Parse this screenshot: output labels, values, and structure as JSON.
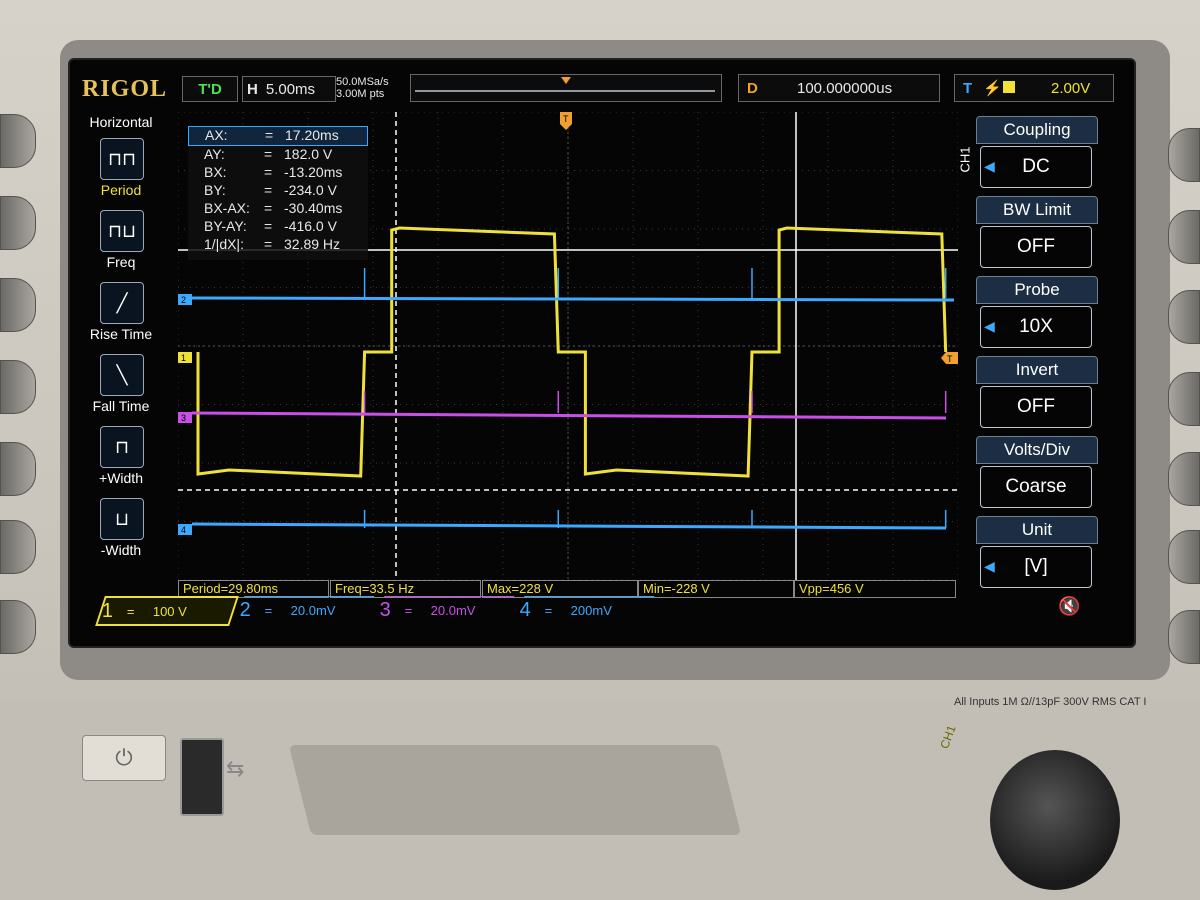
{
  "brand": "RIGOL",
  "topbar": {
    "trigger_status": "T'D",
    "horizontal_letter": "H",
    "timebase": "5.00ms",
    "sample_rate": "50.0MSa/s",
    "memory_depth": "3.00M pts",
    "delay_label": "D",
    "delay_value": "100.000000us",
    "trigger_letter": "T",
    "trigger_edge_icon": "rising-edge-icon",
    "trigger_level": "2.00V"
  },
  "left_menu": {
    "title": "Horizontal",
    "items": [
      {
        "label": "Period",
        "icon": "period-icon",
        "selected": true
      },
      {
        "label": "Freq",
        "icon": "freq-icon",
        "selected": false
      },
      {
        "label": "Rise Time",
        "icon": "rise-time-icon",
        "selected": false
      },
      {
        "label": "Fall Time",
        "icon": "fall-time-icon",
        "selected": false
      },
      {
        "label": "+Width",
        "icon": "pos-width-icon",
        "selected": false
      },
      {
        "label": "-Width",
        "icon": "neg-width-icon",
        "selected": false
      }
    ]
  },
  "cursor_readout": {
    "rows": [
      {
        "key": "AX:",
        "value": "17.20ms"
      },
      {
        "key": "AY:",
        "value": "182.0 V"
      },
      {
        "key": "BX:",
        "value": "-13.20ms"
      },
      {
        "key": "BY:",
        "value": "-234.0 V"
      },
      {
        "key": "BX-AX:",
        "value": "-30.40ms"
      },
      {
        "key": "BY-AY:",
        "value": "-416.0 V"
      },
      {
        "key": "1/|dX|:",
        "value": "32.89 Hz"
      }
    ]
  },
  "right_menu": {
    "channel_tag": "CH1",
    "items": [
      {
        "title": "Coupling",
        "value": "DC",
        "arrow": true
      },
      {
        "title": "BW Limit",
        "value": "OFF",
        "arrow": false
      },
      {
        "title": "Probe",
        "value": "10X",
        "arrow": true
      },
      {
        "title": "Invert",
        "value": "OFF",
        "arrow": false
      },
      {
        "title": "Volts/Div",
        "value": "Coarse",
        "arrow": false
      },
      {
        "title": "Unit",
        "value": "[V]",
        "arrow": true
      }
    ]
  },
  "measurements": [
    {
      "text": "Period=29.80ms"
    },
    {
      "text": "Freq=33.5 Hz"
    },
    {
      "text": "Max=228 V"
    },
    {
      "text": "Min=-228 V"
    },
    {
      "text": "Vpp=456 V"
    }
  ],
  "channels": [
    {
      "num": "1",
      "coupling": "=",
      "scale": "100 V",
      "color": "#f0e03a"
    },
    {
      "num": "2",
      "coupling": "=",
      "scale": "20.0mV",
      "color": "#3ea8ff"
    },
    {
      "num": "3",
      "coupling": "=",
      "scale": "20.0mV",
      "color": "#c850e8"
    },
    {
      "num": "4",
      "coupling": "=",
      "scale": "200mV",
      "color": "#3ea8ff"
    }
  ],
  "trace_markers": {
    "ch2": "2",
    "ch1": "1",
    "ch3": "3",
    "ch4": "4",
    "trigger_right": "T",
    "trigger_top": "T"
  },
  "hardware": {
    "input_label": "All Inputs 1M Ω//13pF 300V RMS  CAT I",
    "bnc_label": "CH1",
    "power_icon": "power-icon",
    "usb_icon": "usb-icon",
    "mute_icon": "speaker-mute-icon"
  },
  "colors": {
    "ch1": "#f0e03a",
    "ch2": "#3ea8ff",
    "ch3": "#c850e8",
    "ch4": "#3ea8ff",
    "trigger": "#f0a030",
    "cursor": "#ffffff"
  }
}
